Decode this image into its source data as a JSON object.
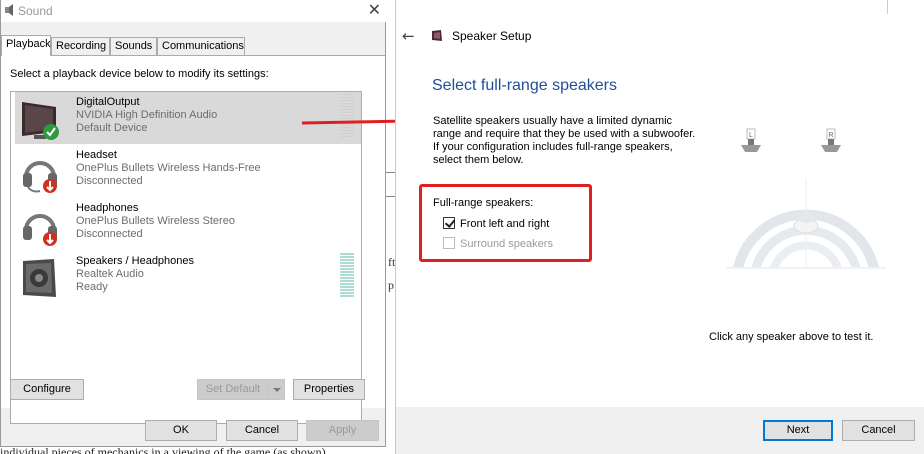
{
  "sound": {
    "title": "Sound",
    "tabs": [
      {
        "label": "Playback"
      },
      {
        "label": "Recording"
      },
      {
        "label": "Sounds"
      },
      {
        "label": "Communications"
      }
    ],
    "instruction": "Select a playback device below to modify its settings:",
    "devices": [
      {
        "name": "DigitalOutput",
        "description": "NVIDIA High Definition Audio",
        "status": "Default Device",
        "icon": "monitor-icon",
        "badge": "checkmark-icon"
      },
      {
        "name": "Headset",
        "description": "OnePlus Bullets Wireless Hands-Free",
        "status": "Disconnected",
        "icon": "headset-icon",
        "badge": "down-arrow-icon"
      },
      {
        "name": "Headphones",
        "description": "OnePlus Bullets Wireless Stereo",
        "status": "Disconnected",
        "icon": "headphones-icon",
        "badge": "down-arrow-icon"
      },
      {
        "name": "Speakers / Headphones",
        "description": "Realtek Audio",
        "status": "Ready",
        "icon": "speaker-icon"
      }
    ],
    "buttons": {
      "configure": "Configure",
      "set_default": "Set Default",
      "properties": "Properties",
      "ok": "OK",
      "cancel": "Cancel",
      "apply": "Apply"
    }
  },
  "setup": {
    "title": "Speaker Setup",
    "heading": "Select full-range speakers",
    "description": "Satellite speakers usually have a limited dynamic range and require that they be used with a subwoofer.  If your configuration includes full-range speakers, select them below.",
    "group_label": "Full-range speakers:",
    "options": [
      {
        "label": "Front left and right",
        "checked": true,
        "enabled": true
      },
      {
        "label": "Surround speakers",
        "checked": false,
        "enabled": false
      }
    ],
    "speaker_labels": {
      "left": "L",
      "right": "R"
    },
    "test_hint": "Click any speaker above to test it.",
    "buttons": {
      "next": "Next",
      "cancel": "Cancel"
    }
  },
  "background": {
    "fragments": [
      "ft",
      "p"
    ],
    "bottom_text": "individual pieces of mechanics in a viewing of the game (as shown)"
  },
  "colors": {
    "annotation_red": "#e02020",
    "heading_blue": "#1f4e9a",
    "selection_gray": "#d9d9d9"
  }
}
